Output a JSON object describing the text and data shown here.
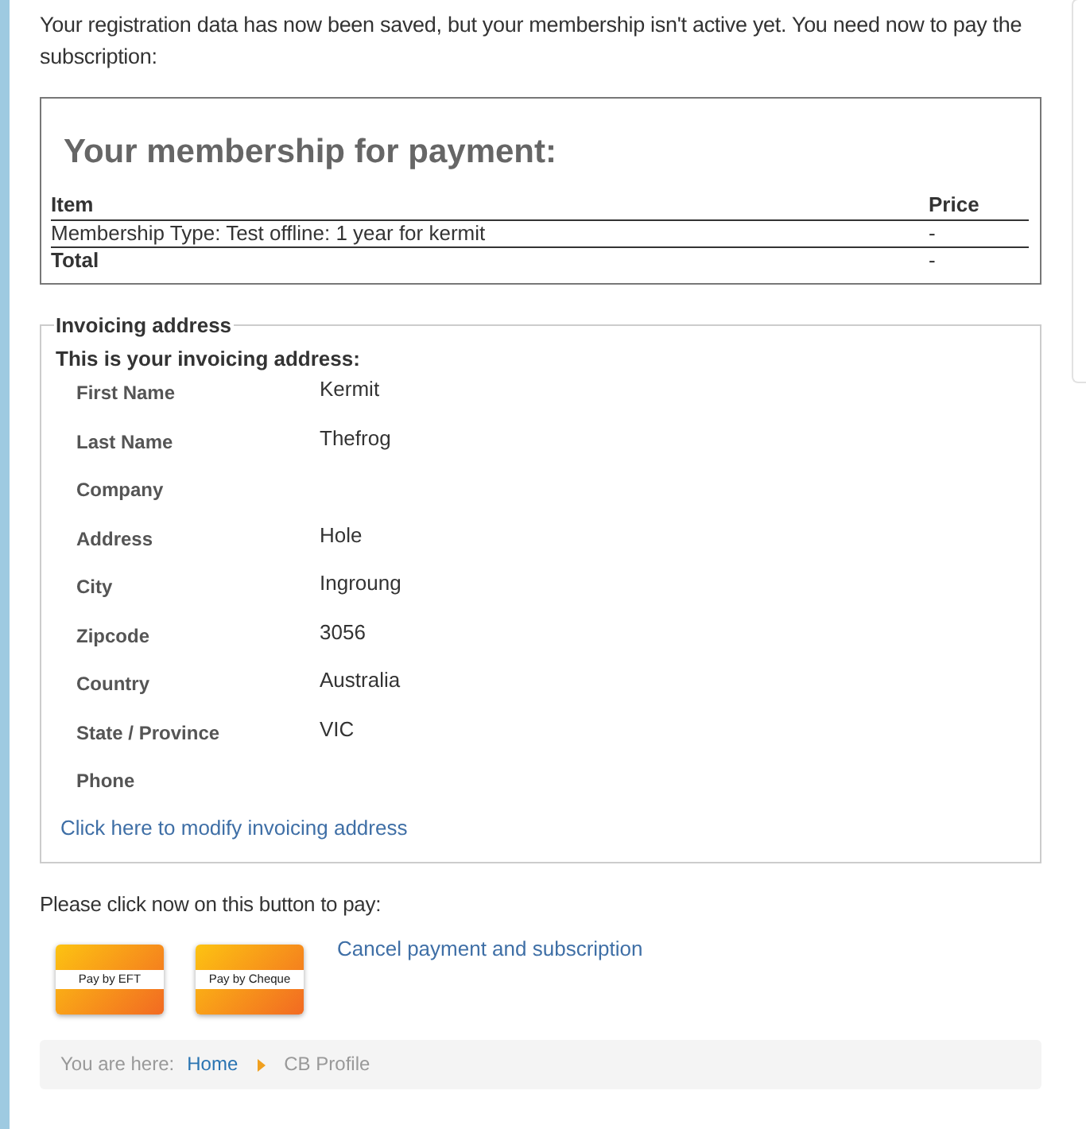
{
  "intro": "Your registration data has now been saved, but your membership isn't active yet. You need now to pay the subscription:",
  "membership": {
    "title": "Your membership for payment:",
    "columns": [
      "Item",
      "Price"
    ],
    "rows": [
      {
        "item": "Membership Type: Test offline: 1 year for kermit",
        "price": "-"
      }
    ],
    "total": {
      "label": "Total",
      "price": "-"
    }
  },
  "invoicing": {
    "legend": "Invoicing address",
    "heading": "This is your invoicing address:",
    "fields": [
      {
        "label": "First Name",
        "value": "Kermit"
      },
      {
        "label": "Last Name",
        "value": "Thefrog"
      },
      {
        "label": "Company"
      },
      {
        "label": "Address",
        "value": "Hole"
      },
      {
        "label": "City",
        "value": "Ingroung"
      },
      {
        "label": "Zipcode",
        "value": "3056"
      },
      {
        "label": "Country",
        "value": "Australia"
      },
      {
        "label": "State / Province",
        "value": "VIC"
      },
      {
        "label": "Phone"
      }
    ],
    "modify_link": "Click here to modify invoicing address"
  },
  "pay_prompt": "Please click now on this button to pay:",
  "pay_buttons": [
    "Pay by EFT",
    "Pay by Cheque"
  ],
  "cancel_link": "Cancel payment and subscription",
  "breadcrumb": {
    "prefix": "You are here:",
    "items": [
      {
        "label": "Home",
        "kind": "link"
      },
      {
        "label": "CB Profile",
        "kind": "current"
      }
    ]
  }
}
